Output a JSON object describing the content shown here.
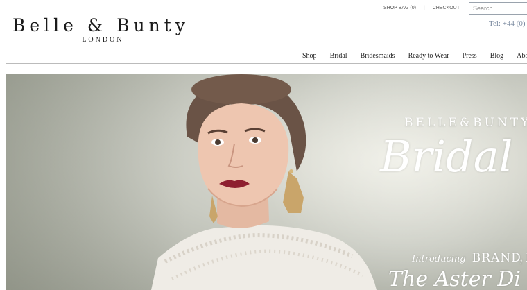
{
  "header": {
    "logo_main": "Belle & Bunty",
    "logo_sub": "LONDON",
    "shop_bag": "SHOP BAG (0)",
    "separator": "|",
    "checkout": "CHECKOUT",
    "search_placeholder": "Search",
    "phone": "Tel: +44 (0)"
  },
  "nav": {
    "items": [
      "Shop",
      "Bridal",
      "Bridesmaids",
      "Ready to Wear",
      "Press",
      "Blog",
      "About us"
    ]
  },
  "hero": {
    "brand_small": "BELLE&BUNTY",
    "brand_script": "Bridal",
    "intro_small": "Introducing",
    "intro_big": "BRAND NEW S",
    "collection_mid": "i",
    "collection": "The Aster Di"
  },
  "colors": {
    "accent_text": "#7a8aa0",
    "search_border": "#9aa3ad",
    "divider": "#bbbbbb"
  }
}
